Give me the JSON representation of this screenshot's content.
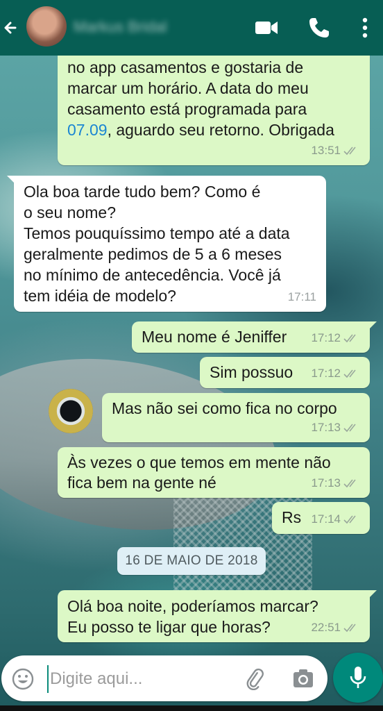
{
  "header": {
    "contact_name": "Markus Bridal",
    "icons": {
      "back": "arrow-left-icon",
      "video": "video-call-icon",
      "call": "phone-icon",
      "menu": "more-vert-icon"
    }
  },
  "messages": [
    {
      "direction": "out",
      "text_before_link": "no app casamentos e gostaria de\nmarcar um horário. A data do meu\ncasamento está programada para\n",
      "link": "07.09",
      "text_after_link": ", aguardo seu retorno. Obrigada",
      "time": "13:51",
      "status": "read"
    },
    {
      "direction": "in",
      "text": "Ola boa tarde tudo bem? Como é\no seu nome?\nTemos pouquíssimo tempo até a data\ngeralmente pedimos de 5 a 6 meses\nno mínimo de antecedência. Você já\ntem idéia de modelo?",
      "time": "17:11"
    },
    {
      "direction": "out",
      "text": "Meu nome é Jeniffer",
      "time": "17:12",
      "status": "read"
    },
    {
      "direction": "out",
      "text": "Sim possuo",
      "time": "17:12",
      "status": "read"
    },
    {
      "direction": "out",
      "text": "Mas não sei como fica no corpo",
      "time": "17:13",
      "status": "read"
    },
    {
      "direction": "out",
      "text": "Às vezes o que temos em mente não\nfica bem na gente né",
      "time": "17:13",
      "status": "read"
    },
    {
      "direction": "out",
      "text": "Rs",
      "time": "17:14",
      "status": "read"
    },
    {
      "direction": "out",
      "text": "Olá boa noite, poderíamos marcar?\nEu posso te ligar que horas?",
      "time": "22:51",
      "status": "read"
    }
  ],
  "date_separator": "16 DE MAIO DE 2018",
  "input": {
    "placeholder": "Digite aqui..."
  },
  "colors": {
    "header": "#075e54",
    "outgoing": "#dcf8c6",
    "incoming": "#ffffff",
    "accent": "#00897b",
    "link": "#1b86d2"
  }
}
